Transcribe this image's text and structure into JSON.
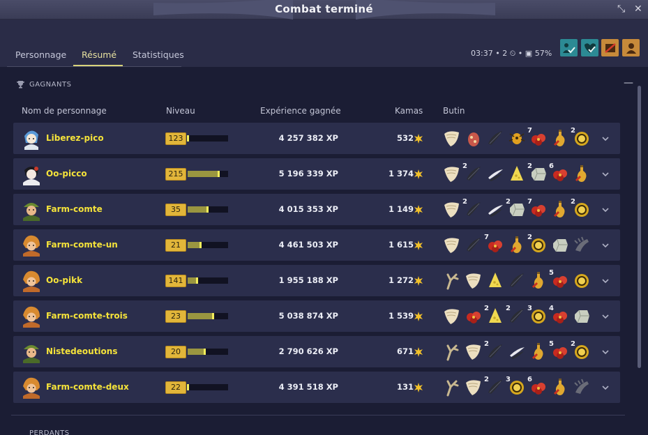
{
  "window": {
    "title": "Combat terminé"
  },
  "tabs": [
    {
      "label": "Personnage"
    },
    {
      "label": "Résumé"
    },
    {
      "label": "Statistiques"
    }
  ],
  "fight_info": {
    "duration": "03:37",
    "turns": "2",
    "percent": "57%"
  },
  "section": {
    "winners_title": "GAGNANTS",
    "losers_title": "PERDANTS"
  },
  "headers": {
    "name": "Nom de personnage",
    "level": "Niveau",
    "xp": "Expérience gagnée",
    "kamas": "Kamas",
    "loot": "Butin"
  },
  "rows": [
    {
      "name": "Liberez-pico",
      "level": "123",
      "level_progress": 0.03,
      "xp": "4 257 382 XP",
      "kamas": "532",
      "loot": [
        [
          "shell",
          ""
        ],
        [
          "egg",
          ""
        ],
        [
          "feather",
          ""
        ],
        [
          "bug",
          ""
        ],
        [
          "redflower",
          "7"
        ],
        [
          "potion",
          ""
        ],
        [
          "coin",
          "2"
        ]
      ]
    },
    {
      "name": "Oo-picco",
      "level": "215",
      "level_progress": 0.8,
      "xp": "5 196 339 XP",
      "kamas": "1 374",
      "loot": [
        [
          "shell",
          ""
        ],
        [
          "feather",
          "2"
        ],
        [
          "wing",
          ""
        ],
        [
          "cheese",
          ""
        ],
        [
          "stone",
          "2"
        ],
        [
          "redflower",
          "6"
        ],
        [
          "potion",
          ""
        ]
      ]
    },
    {
      "name": "Farm-comte",
      "level": "35",
      "level_progress": 0.52,
      "xp": "4 015 353 XP",
      "kamas": "1 149",
      "loot": [
        [
          "shell",
          ""
        ],
        [
          "feather",
          "2"
        ],
        [
          "wing",
          ""
        ],
        [
          "stone",
          "2"
        ],
        [
          "redflower",
          "7"
        ],
        [
          "potion",
          ""
        ],
        [
          "coin",
          "2"
        ]
      ]
    },
    {
      "name": "Farm-comte-un",
      "level": "21",
      "level_progress": 0.35,
      "xp": "4 461 503 XP",
      "kamas": "1 615",
      "loot": [
        [
          "shell",
          ""
        ],
        [
          "feather",
          ""
        ],
        [
          "redflower",
          "7"
        ],
        [
          "potion",
          ""
        ],
        [
          "coin",
          "2"
        ],
        [
          "stone",
          ""
        ],
        [
          "claw",
          ""
        ]
      ]
    },
    {
      "name": "Oo-pikk",
      "level": "141",
      "level_progress": 0.25,
      "xp": "1 955 188 XP",
      "kamas": "1 272",
      "loot": [
        [
          "branch",
          ""
        ],
        [
          "shell",
          ""
        ],
        [
          "cheese",
          ""
        ],
        [
          "feather",
          ""
        ],
        [
          "potion",
          ""
        ],
        [
          "redflower",
          "5"
        ],
        [
          "coin",
          ""
        ]
      ]
    },
    {
      "name": "Farm-comte-trois",
      "level": "23",
      "level_progress": 0.65,
      "xp": "5 038 874 XP",
      "kamas": "1 539",
      "loot": [
        [
          "shell",
          ""
        ],
        [
          "redflower",
          ""
        ],
        [
          "cheese",
          "2"
        ],
        [
          "feather",
          "2"
        ],
        [
          "coin",
          "3"
        ],
        [
          "redflower",
          "4"
        ],
        [
          "stone",
          ""
        ]
      ]
    },
    {
      "name": "Nistedeoutions",
      "level": "20",
      "level_progress": 0.45,
      "xp": "2 790 626 XP",
      "kamas": "671",
      "loot": [
        [
          "branch",
          ""
        ],
        [
          "shell",
          ""
        ],
        [
          "feather",
          "2"
        ],
        [
          "wing",
          ""
        ],
        [
          "potion",
          ""
        ],
        [
          "redflower",
          "5"
        ],
        [
          "coin",
          "2"
        ]
      ]
    },
    {
      "name": "Farm-comte-deux",
      "level": "22",
      "level_progress": 0.03,
      "xp": "4 391 518 XP",
      "kamas": "131",
      "loot": [
        [
          "branch",
          ""
        ],
        [
          "shell",
          ""
        ],
        [
          "feather",
          "2"
        ],
        [
          "coin",
          "3"
        ],
        [
          "redflower",
          "6"
        ],
        [
          "potion",
          ""
        ],
        [
          "claw",
          ""
        ]
      ]
    }
  ],
  "avatars": [
    "blue-white",
    "black-white",
    "green-helmet",
    "orange-hair",
    "orange-hair",
    "orange-hair",
    "green-helmet",
    "orange-hair"
  ],
  "colors": {
    "name": "#f5e33a",
    "level_badge": "#e2b63a",
    "row_bg": "#2b2e4c",
    "accent": "#d9d37a"
  }
}
